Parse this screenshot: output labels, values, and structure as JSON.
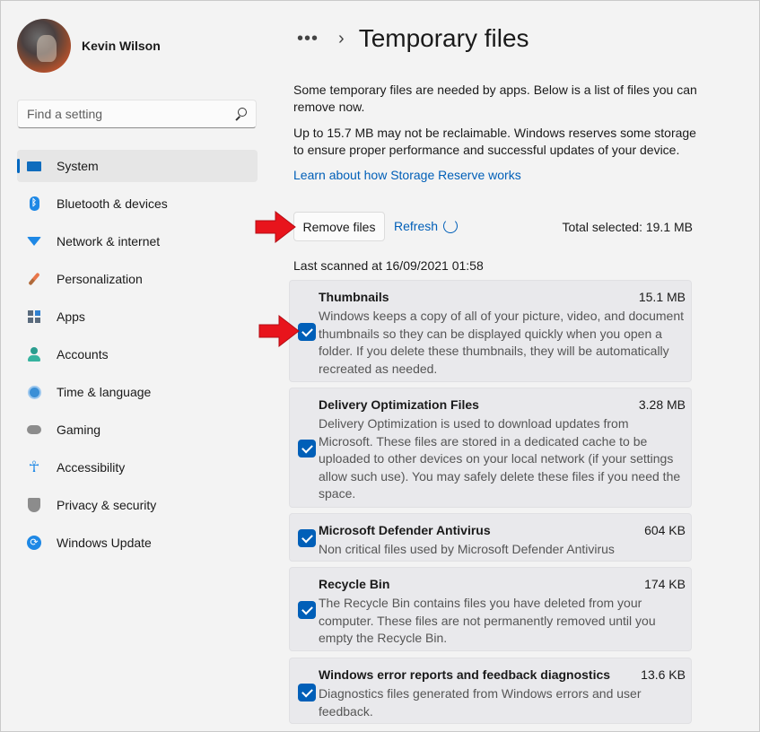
{
  "profile": {
    "name": "Kevin Wilson"
  },
  "search": {
    "placeholder": "Find a setting"
  },
  "nav": {
    "items": [
      {
        "label": "System",
        "icon": "system-icon"
      },
      {
        "label": "Bluetooth & devices",
        "icon": "bluetooth-icon"
      },
      {
        "label": "Network & internet",
        "icon": "network-icon"
      },
      {
        "label": "Personalization",
        "icon": "brush-icon"
      },
      {
        "label": "Apps",
        "icon": "apps-icon"
      },
      {
        "label": "Accounts",
        "icon": "accounts-icon"
      },
      {
        "label": "Time & language",
        "icon": "clock-icon"
      },
      {
        "label": "Gaming",
        "icon": "gamepad-icon"
      },
      {
        "label": "Accessibility",
        "icon": "accessibility-icon"
      },
      {
        "label": "Privacy & security",
        "icon": "shield-icon"
      },
      {
        "label": "Windows Update",
        "icon": "update-icon"
      }
    ],
    "active": "System"
  },
  "header": {
    "breadcrumb_dots": "•••",
    "separator": "›",
    "title": "Temporary files"
  },
  "intro": {
    "line1": "Some temporary files are needed by apps. Below is a list of files you can remove now.",
    "line2": "Up to 15.7 MB may not be reclaimable. Windows reserves some storage to ensure proper performance and successful updates of your device.",
    "link": "Learn about how Storage Reserve works"
  },
  "actions": {
    "remove_label": "Remove files",
    "refresh_label": "Refresh",
    "total_selected": "Total selected: 19.1 MB",
    "last_scanned": "Last scanned at 16/09/2021 01:58"
  },
  "files": [
    {
      "name": "Thumbnails",
      "size": "15.1 MB",
      "checked": true,
      "desc": "Windows keeps a copy of all of your picture, video, and document thumbnails so they can be displayed quickly when you open a folder. If you delete these thumbnails, they will be automatically recreated as needed."
    },
    {
      "name": "Delivery Optimization Files",
      "size": "3.28 MB",
      "checked": true,
      "desc": "Delivery Optimization is used to download updates from Microsoft. These files are stored in a dedicated cache to be uploaded to other devices on your local network (if your settings allow such use). You may safely delete these files if you need the space."
    },
    {
      "name": "Microsoft Defender Antivirus",
      "size": "604 KB",
      "checked": true,
      "desc": "Non critical files used by Microsoft Defender Antivirus"
    },
    {
      "name": "Recycle Bin",
      "size": "174 KB",
      "checked": true,
      "desc": "The Recycle Bin contains files you have deleted from your computer. These files are not permanently removed until you empty the Recycle Bin."
    },
    {
      "name": "Windows error reports and feedback diagnostics",
      "size": "13.6 KB",
      "checked": true,
      "desc": "Diagnostics files generated from Windows errors and user feedback."
    }
  ],
  "colors": {
    "accent": "#005fb8",
    "annotation_arrow": "#e8141c"
  }
}
